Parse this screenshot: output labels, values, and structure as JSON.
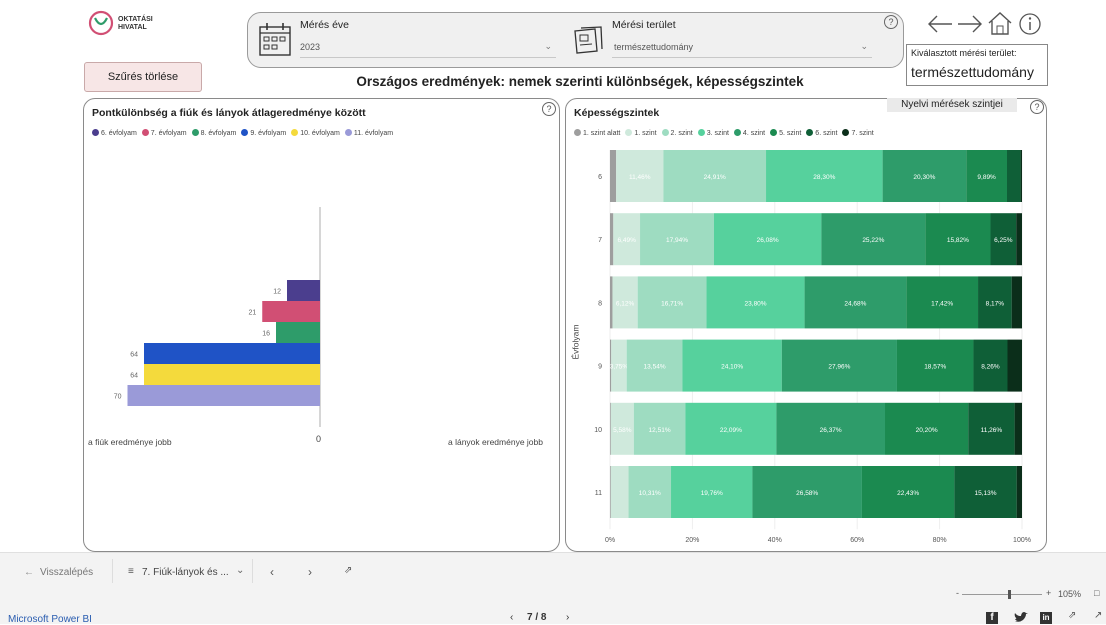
{
  "logo": {
    "line1": "OKTATÁSI",
    "line2": "HIVATAL"
  },
  "filters": {
    "year_label": "Mérés éve",
    "year_value": "2023",
    "area_label": "Mérési terület",
    "area_value": "természettudomány"
  },
  "clear_button": "Szűrés törlése",
  "page_title": "Országos eredmények: nemek szerinti különbségek, képességszintek",
  "selected_area": {
    "label": "Kiválasztott mérési terület:",
    "value": "természettudomány"
  },
  "left_panel": {
    "title": "Pontkülönbség a fiúk és lányok átlageredménye között",
    "legend": [
      {
        "label": "6. évfolyam",
        "color": "#4b3e8e"
      },
      {
        "label": "7. évfolyam",
        "color": "#d14f74"
      },
      {
        "label": "8. évfolyam",
        "color": "#2e9c6a"
      },
      {
        "label": "9. évfolyam",
        "color": "#1f53c6"
      },
      {
        "label": "10. évfolyam",
        "color": "#f4da3c"
      },
      {
        "label": "11. évfolyam",
        "color": "#9a9ad8"
      }
    ],
    "left_caption": "a fiúk eredménye jobb",
    "right_caption": "a lányok eredménye jobb",
    "zero_label": "0"
  },
  "right_panel": {
    "title": "Képességszintek",
    "lang_button": "Nyelvi mérések szintjei",
    "y_axis_label": "Évfolyam"
  },
  "chart_data": [
    {
      "type": "bar",
      "orientation": "horizontal",
      "categories": [
        "6. évfolyam",
        "7. évfolyam",
        "8. évfolyam",
        "9. évfolyam",
        "10. évfolyam",
        "11. évfolyam"
      ],
      "values": [
        12,
        21,
        16,
        64,
        64,
        70
      ],
      "direction": "fiúk eredménye jobb",
      "colors": [
        "#4b3e8e",
        "#d14f74",
        "#2e9c6a",
        "#1f53c6",
        "#f4da3c",
        "#9a9ad8"
      ]
    },
    {
      "type": "bar",
      "orientation": "horizontal",
      "stacked": "percent",
      "categories": [
        "6",
        "7",
        "8",
        "9",
        "10",
        "11"
      ],
      "xticks": [
        "0%",
        "20%",
        "40%",
        "60%",
        "80%",
        "100%"
      ],
      "legend": [
        "1. szint alatt",
        "1. szint",
        "2. szint",
        "3. szint",
        "4. szint",
        "5. szint",
        "6. szint",
        "7. szint"
      ],
      "colors": [
        "#9e9e9e",
        "#cfe9dc",
        "#9edcc1",
        "#56d19d",
        "#2e9c6a",
        "#1b8a50",
        "#0f5f37",
        "#0b2e1a"
      ],
      "series": [
        {
          "name": "1. szint alatt",
          "values": [
            1.5,
            0.8,
            0.6,
            0.3,
            0.2,
            0.2
          ]
        },
        {
          "name": "1. szint",
          "values": [
            11.46,
            6.49,
            6.12,
            3.75,
            5.58,
            4.3
          ]
        },
        {
          "name": "2. szint",
          "values": [
            24.91,
            17.94,
            16.71,
            13.54,
            12.51,
            10.31
          ]
        },
        {
          "name": "3. szint",
          "values": [
            28.3,
            26.08,
            23.8,
            24.1,
            22.09,
            19.76
          ]
        },
        {
          "name": "4. szint",
          "values": [
            20.3,
            25.22,
            24.68,
            27.96,
            26.37,
            26.58
          ]
        },
        {
          "name": "5. szint",
          "values": [
            9.89,
            15.82,
            17.42,
            18.57,
            20.2,
            22.43
          ]
        },
        {
          "name": "6. szint",
          "values": [
            3.3,
            6.25,
            8.17,
            8.26,
            11.26,
            15.13
          ]
        },
        {
          "name": "7. szint",
          "values": [
            0.34,
            1.4,
            2.5,
            3.52,
            1.79,
            1.29
          ]
        }
      ],
      "labels": [
        [
          "",
          "11,46%",
          "24,91%",
          "28,30%",
          "20,30%",
          "9,89%",
          "",
          ""
        ],
        [
          "",
          "6,49%",
          "17,94%",
          "26,08%",
          "25,22%",
          "15,82%",
          "6,25%",
          ""
        ],
        [
          "",
          "6,12%",
          "16,71%",
          "23,80%",
          "24,68%",
          "17,42%",
          "8,17%",
          ""
        ],
        [
          "",
          "3,75%",
          "13,54%",
          "24,10%",
          "27,96%",
          "18,57%",
          "8,26%",
          ""
        ],
        [
          "",
          "5,58%",
          "12,51%",
          "22,09%",
          "26,37%",
          "20,20%",
          "11,26%",
          ""
        ],
        [
          "",
          "",
          "10,31%",
          "19,76%",
          "26,58%",
          "22,43%",
          "15,13%",
          ""
        ]
      ]
    }
  ],
  "bottom_nav": {
    "back": "Visszalépés",
    "page_name": "7. Fiúk-lányok és ...",
    "zoom": "105%",
    "page_indicator": "7 / 8"
  },
  "brand": "Microsoft Power BI"
}
